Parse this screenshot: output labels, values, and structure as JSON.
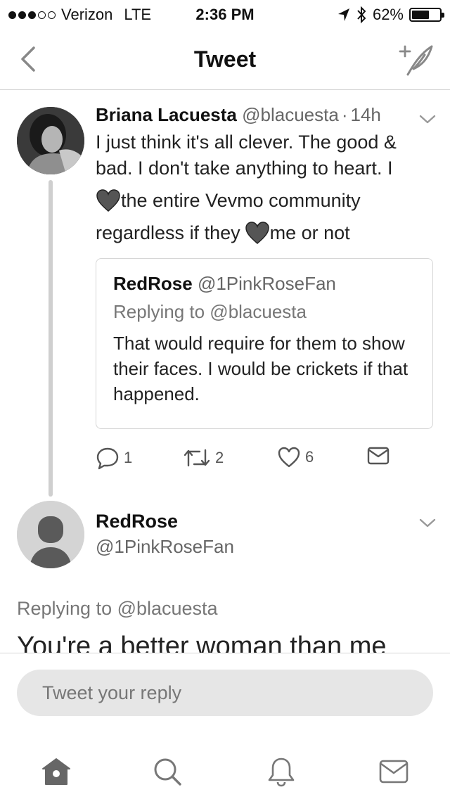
{
  "status_bar": {
    "carrier": "Verizon",
    "network": "LTE",
    "time": "2:36 PM",
    "battery": "62%",
    "battery_level": 0.62,
    "signal_bars_filled": 3,
    "signal_bars_total": 5
  },
  "nav": {
    "title": "Tweet",
    "back_icon": "chevron-left-icon",
    "compose_icon": "compose-tweet-icon"
  },
  "tweet": {
    "author_name": "Briana Lacuesta",
    "author_handle": "@blacuesta",
    "separator": "·",
    "time": "14h",
    "text_lines": [
      "I just think it's all clever. The good &",
      "bad. I don't take anything to heart. I",
      "the entire Vevmo community",
      "regardless if they",
      "me or not"
    ],
    "emoji_icon": "black-heart-icon",
    "quoted": {
      "author_name": "RedRose",
      "author_handle": "@1PinkRoseFan",
      "replying_to": "Replying to @blacuesta",
      "text": "That would require for them to show their faces. I would be crickets if that happened."
    },
    "actions": {
      "replies": "1",
      "retweets": "2",
      "likes": "6"
    }
  },
  "reply": {
    "author_name": "RedRose",
    "author_handle": "@1PinkRoseFan",
    "replying_to": "Replying to @blacuesta",
    "text": "You're a better woman than me"
  },
  "composer": {
    "placeholder": "Tweet your reply"
  },
  "tabbar": {
    "items": [
      "home-icon",
      "search-icon",
      "notifications-icon",
      "messages-icon"
    ]
  }
}
